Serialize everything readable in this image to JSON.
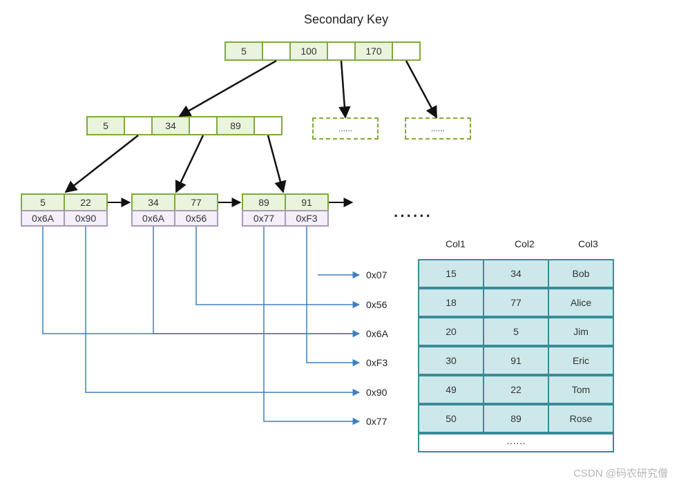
{
  "title": "Secondary Key",
  "root": [
    "5",
    "100",
    "170"
  ],
  "mid": [
    "5",
    "34",
    "89"
  ],
  "leaves": [
    {
      "keys": [
        "5",
        "22"
      ],
      "ptrs": [
        "0x6A",
        "0x90"
      ]
    },
    {
      "keys": [
        "34",
        "77"
      ],
      "ptrs": [
        "0x6A",
        "0x56"
      ]
    },
    {
      "keys": [
        "89",
        "91"
      ],
      "ptrs": [
        "0x77",
        "0xF3"
      ]
    }
  ],
  "ghost_label": "......",
  "dots_inline": "······",
  "row_addr": [
    "0x07",
    "0x56",
    "0x6A",
    "0xF3",
    "0x90",
    "0x77"
  ],
  "table": {
    "headers": [
      "Col1",
      "Col2",
      "Col3"
    ],
    "rows": [
      [
        "15",
        "34",
        "Bob"
      ],
      [
        "18",
        "77",
        "Alice"
      ],
      [
        "20",
        "5",
        "Jim"
      ],
      [
        "30",
        "91",
        "Eric"
      ],
      [
        "49",
        "22",
        "Tom"
      ],
      [
        "50",
        "89",
        "Rose"
      ]
    ],
    "more": "······"
  },
  "watermark": "CSDN @码农研究僧"
}
